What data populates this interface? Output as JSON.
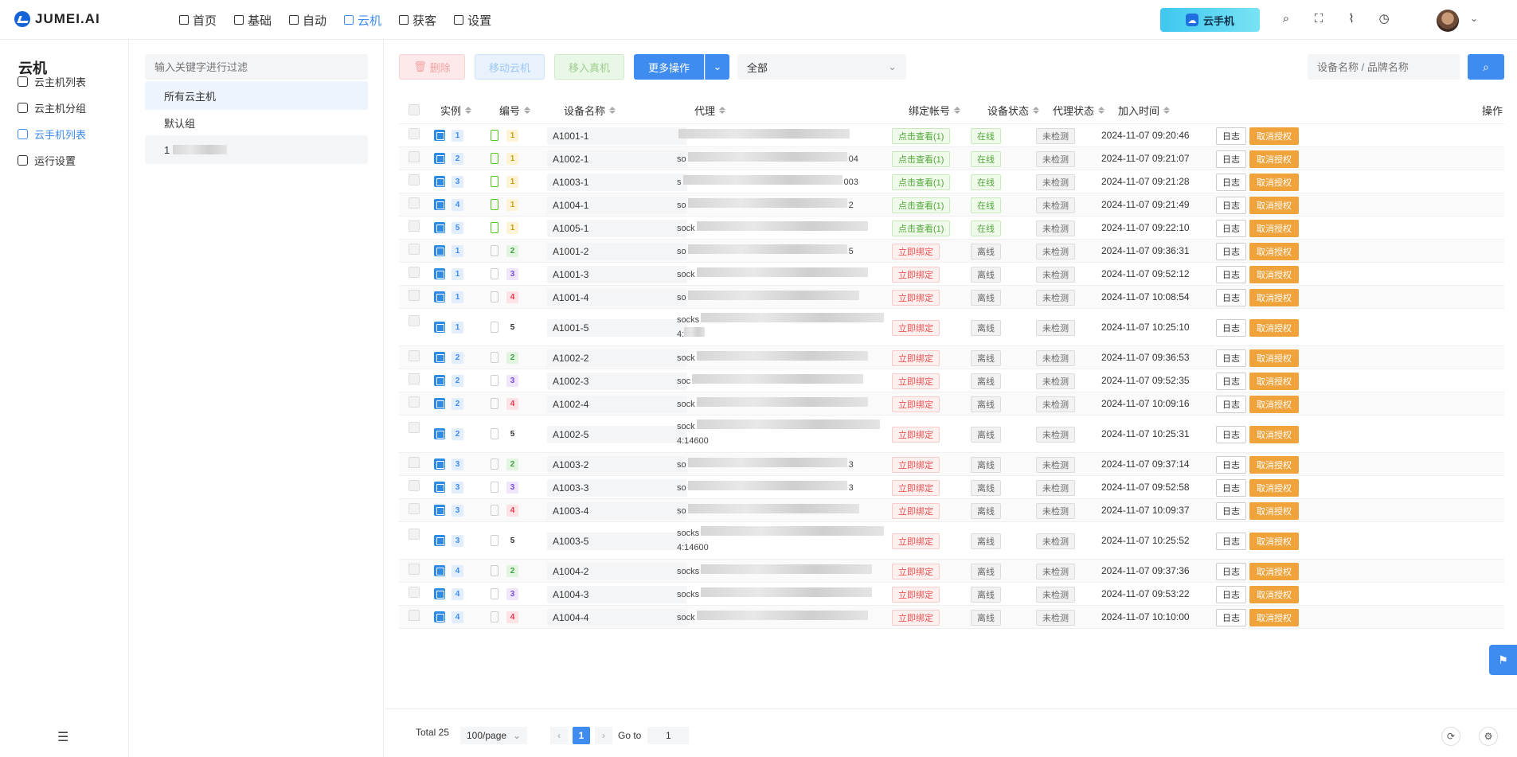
{
  "app": {
    "logo_text": "JUMEI.AI"
  },
  "nav": [
    {
      "label": "首页",
      "icon": "home-icon"
    },
    {
      "label": "基础",
      "icon": "phone-icon"
    },
    {
      "label": "自动",
      "icon": "flow-icon"
    },
    {
      "label": "云机",
      "icon": "cloud-doc-icon",
      "active": true
    },
    {
      "label": "获客",
      "icon": "doc-icon"
    },
    {
      "label": "设置",
      "icon": "gear-icon"
    }
  ],
  "promo": {
    "label": "云手机"
  },
  "sidebar": {
    "title": "云机",
    "items": [
      {
        "label": "云主机列表",
        "icon": "phone-icon"
      },
      {
        "label": "云主机分组",
        "icon": "database-icon"
      },
      {
        "label": "云手机列表",
        "icon": "phone-icon",
        "active": true
      },
      {
        "label": "运行设置",
        "icon": "gear-icon"
      }
    ]
  },
  "groups": {
    "search_placeholder": "输入关键字进行过滤",
    "items": [
      {
        "label": "所有云主机",
        "active": true
      },
      {
        "label": "默认组"
      },
      {
        "label": "1"
      }
    ]
  },
  "toolbar": {
    "delete_label": "删除",
    "move_label": "移动云机",
    "real_label": "移入真机",
    "more_label": "更多操作",
    "filter_value": "全部",
    "search_placeholder": "设备名称 / 品牌名称"
  },
  "table": {
    "headers": {
      "instance": "实例",
      "number": "编号",
      "device_name": "设备名称",
      "proxy": "代理",
      "bind": "绑定帐号",
      "device_status": "设备状态",
      "proxy_status": "代理状态",
      "join_time": "加入时间",
      "action": "操作"
    },
    "log_label": "日志",
    "cancel_label": "取消授权",
    "rows": [
      {
        "inst": "1",
        "num": "1",
        "numColor": "yellow",
        "online": true,
        "name": "A1001-1",
        "proxyA": "",
        "proxyB": "",
        "bind": "点击查看(1)",
        "status": "在线",
        "pstatus": "未检测",
        "time": "2024-11-07 09:20:46",
        "tall": false
      },
      {
        "inst": "2",
        "num": "1",
        "numColor": "yellow",
        "online": true,
        "name": "A1002-1",
        "proxyA": "so",
        "proxyB": "04",
        "bind": "点击查看(1)",
        "status": "在线",
        "pstatus": "未检测",
        "time": "2024-11-07 09:21:07",
        "tall": false
      },
      {
        "inst": "3",
        "num": "1",
        "numColor": "yellow",
        "online": true,
        "name": "A1003-1",
        "proxyA": "s",
        "proxyB": "003",
        "bind": "点击查看(1)",
        "status": "在线",
        "pstatus": "未检测",
        "time": "2024-11-07 09:21:28",
        "tall": false
      },
      {
        "inst": "4",
        "num": "1",
        "numColor": "yellow",
        "online": true,
        "name": "A1004-1",
        "proxyA": "so",
        "proxyB": "2",
        "bind": "点击查看(1)",
        "status": "在线",
        "pstatus": "未检测",
        "time": "2024-11-07 09:21:49",
        "tall": false
      },
      {
        "inst": "5",
        "num": "1",
        "numColor": "yellow",
        "online": true,
        "name": "A1005-1",
        "proxyA": "sock",
        "proxyB": "",
        "bind": "点击查看(1)",
        "status": "在线",
        "pstatus": "未检测",
        "time": "2024-11-07 09:22:10",
        "tall": false
      },
      {
        "inst": "1",
        "num": "2",
        "numColor": "green",
        "online": false,
        "name": "A1001-2",
        "proxyA": "so",
        "proxyB": "5",
        "bind": "立即绑定",
        "status": "离线",
        "pstatus": "未检测",
        "time": "2024-11-07 09:36:31",
        "tall": false
      },
      {
        "inst": "1",
        "num": "3",
        "numColor": "purple",
        "online": false,
        "name": "A1001-3",
        "proxyA": "sock",
        "proxyB": "",
        "bind": "立即绑定",
        "status": "离线",
        "pstatus": "未检测",
        "time": "2024-11-07 09:52:12",
        "tall": false
      },
      {
        "inst": "1",
        "num": "4",
        "numColor": "red",
        "online": false,
        "name": "A1001-4",
        "proxyA": "so",
        "proxyB": "",
        "bind": "立即绑定",
        "status": "离线",
        "pstatus": "未检测",
        "time": "2024-11-07 10:08:54",
        "tall": false
      },
      {
        "inst": "1",
        "num": "5",
        "numColor": "plain",
        "online": false,
        "name": "A1001-5",
        "proxyA": "socks",
        "proxyB": "4:",
        "bind": "立即绑定",
        "status": "离线",
        "pstatus": "未检测",
        "time": "2024-11-07 10:25:10",
        "tall": true
      },
      {
        "inst": "2",
        "num": "2",
        "numColor": "green",
        "online": false,
        "name": "A1002-2",
        "proxyA": "sock",
        "proxyB": "",
        "bind": "立即绑定",
        "status": "离线",
        "pstatus": "未检测",
        "time": "2024-11-07 09:36:53",
        "tall": false
      },
      {
        "inst": "2",
        "num": "3",
        "numColor": "purple",
        "online": false,
        "name": "A1002-3",
        "proxyA": "soc",
        "proxyB": "",
        "bind": "立即绑定",
        "status": "离线",
        "pstatus": "未检测",
        "time": "2024-11-07 09:52:35",
        "tall": false
      },
      {
        "inst": "2",
        "num": "4",
        "numColor": "red",
        "online": false,
        "name": "A1002-4",
        "proxyA": "sock",
        "proxyB": "",
        "bind": "立即绑定",
        "status": "离线",
        "pstatus": "未检测",
        "time": "2024-11-07 10:09:16",
        "tall": false
      },
      {
        "inst": "2",
        "num": "5",
        "numColor": "plain",
        "online": false,
        "name": "A1002-5",
        "proxyA": "sock",
        "proxyB": "4:14600",
        "bind": "立即绑定",
        "status": "离线",
        "pstatus": "未检测",
        "time": "2024-11-07 10:25:31",
        "tall": true
      },
      {
        "inst": "3",
        "num": "2",
        "numColor": "green",
        "online": false,
        "name": "A1003-2",
        "proxyA": "so",
        "proxyB": "3",
        "bind": "立即绑定",
        "status": "离线",
        "pstatus": "未检测",
        "time": "2024-11-07 09:37:14",
        "tall": false
      },
      {
        "inst": "3",
        "num": "3",
        "numColor": "purple",
        "online": false,
        "name": "A1003-3",
        "proxyA": "so",
        "proxyB": "3",
        "bind": "立即绑定",
        "status": "离线",
        "pstatus": "未检测",
        "time": "2024-11-07 09:52:58",
        "tall": false
      },
      {
        "inst": "3",
        "num": "4",
        "numColor": "red",
        "online": false,
        "name": "A1003-4",
        "proxyA": "so",
        "proxyB": "",
        "bind": "立即绑定",
        "status": "离线",
        "pstatus": "未检测",
        "time": "2024-11-07 10:09:37",
        "tall": false
      },
      {
        "inst": "3",
        "num": "5",
        "numColor": "plain",
        "online": false,
        "name": "A1003-5",
        "proxyA": "socks",
        "proxyB": "4:14600",
        "bind": "立即绑定",
        "status": "离线",
        "pstatus": "未检测",
        "time": "2024-11-07 10:25:52",
        "tall": true
      },
      {
        "inst": "4",
        "num": "2",
        "numColor": "green",
        "online": false,
        "name": "A1004-2",
        "proxyA": "socks",
        "proxyB": "",
        "bind": "立即绑定",
        "status": "离线",
        "pstatus": "未检测",
        "time": "2024-11-07 09:37:36",
        "tall": false
      },
      {
        "inst": "4",
        "num": "3",
        "numColor": "purple",
        "online": false,
        "name": "A1004-3",
        "proxyA": "socks",
        "proxyB": "",
        "bind": "立即绑定",
        "status": "离线",
        "pstatus": "未检测",
        "time": "2024-11-07 09:53:22",
        "tall": false
      },
      {
        "inst": "4",
        "num": "4",
        "numColor": "red",
        "online": false,
        "name": "A1004-4",
        "proxyA": "sock",
        "proxyB": "",
        "bind": "立即绑定",
        "status": "离线",
        "pstatus": "未检测",
        "time": "2024-11-07 10:10:00",
        "tall": false
      }
    ]
  },
  "pagination": {
    "total_label": "Total 25",
    "page_size": "100/page",
    "current_page": "1",
    "goto_label": "Go to",
    "goto_value": "1"
  },
  "colors": {
    "accent": "#3f8cf0",
    "warning": "#f0a33a",
    "online": "#52a83a",
    "danger": "#e85252"
  }
}
